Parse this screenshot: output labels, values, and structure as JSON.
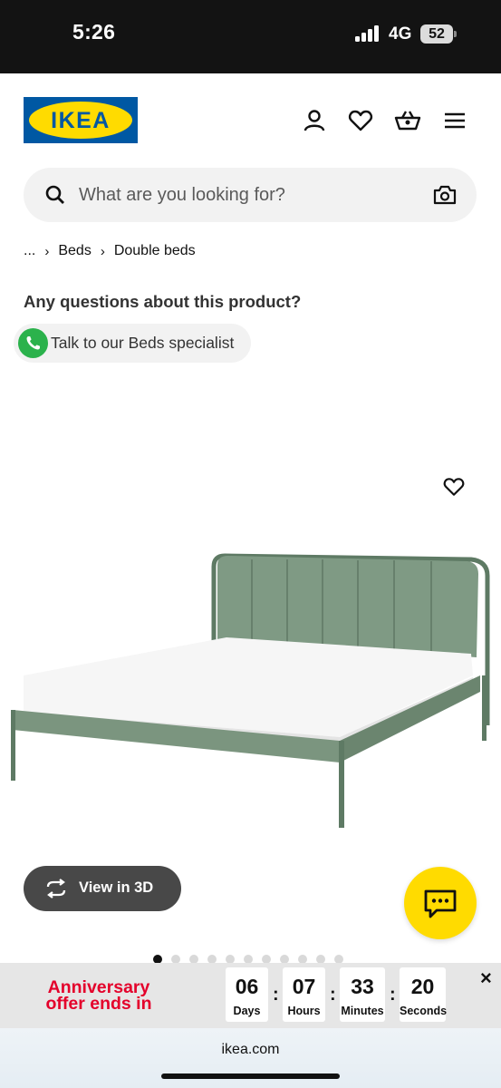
{
  "status_bar": {
    "time": "5:26",
    "network": "4G",
    "battery": "52"
  },
  "header": {
    "logo_text": "IKEA",
    "icons": [
      "profile-icon",
      "heart-icon",
      "basket-icon",
      "menu-icon"
    ]
  },
  "search": {
    "placeholder": "What are you looking for?"
  },
  "breadcrumb": [
    "...",
    "Beds",
    "Double beds"
  ],
  "help": {
    "question": "Any questions about this product?",
    "specialist_label": "Talk to our Beds specialist"
  },
  "product": {
    "view3d_label": "View in 3D",
    "image_dots": 11,
    "active_dot": 0
  },
  "countdown": {
    "title": "Anniversary offer ends in",
    "units": [
      {
        "value": "06",
        "label": "Days"
      },
      {
        "value": "07",
        "label": "Hours"
      },
      {
        "value": "33",
        "label": "Minutes"
      },
      {
        "value": "20",
        "label": "Seconds"
      }
    ],
    "close_label": "×"
  },
  "browser": {
    "url": "ikea.com"
  },
  "colors": {
    "ikea_blue": "#0058a3",
    "ikea_yellow": "#ffdb00",
    "offer_red": "#e4002b",
    "phone_green": "#2bb24c"
  }
}
